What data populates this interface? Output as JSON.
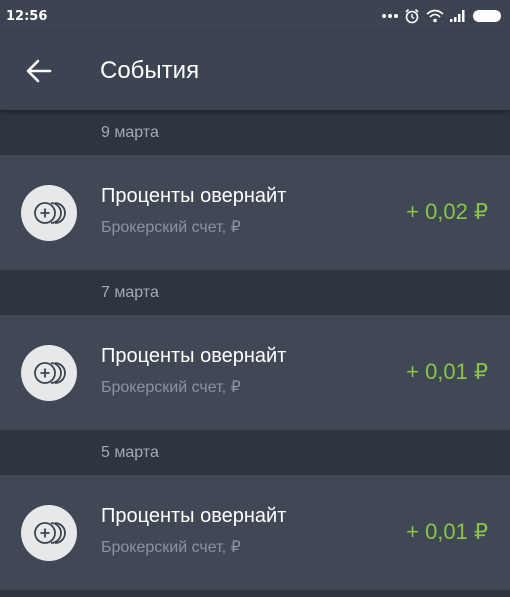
{
  "status_bar": {
    "time": "12:56",
    "icons": [
      "more-dots-icon",
      "alarm-icon",
      "wifi-icon",
      "signal-icon",
      "battery-icon"
    ]
  },
  "app_bar": {
    "back_icon": "arrow-left-icon",
    "title": "События"
  },
  "colors": {
    "background": "#353d4b",
    "app_bar": "#3c4452",
    "date_header": "#2e3541",
    "row": "#404856",
    "amount_positive": "#8bc34a",
    "secondary_text": "#8b93a1"
  },
  "events": [
    {
      "date": "9 марта",
      "title": "Проценты овернайт",
      "subtitle": "Брокерский счет, ₽",
      "amount": "+ 0,02 ₽",
      "icon": "coins-plus-icon"
    },
    {
      "date": "7 марта",
      "title": "Проценты овернайт",
      "subtitle": "Брокерский счет, ₽",
      "amount": "+ 0,01 ₽",
      "icon": "coins-plus-icon"
    },
    {
      "date": "5 марта",
      "title": "Проценты овернайт",
      "subtitle": "Брокерский счет, ₽",
      "amount": "+ 0,01 ₽",
      "icon": "coins-plus-icon"
    }
  ]
}
